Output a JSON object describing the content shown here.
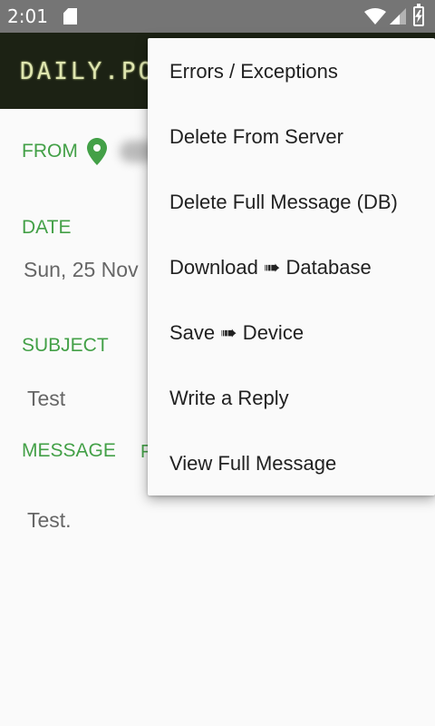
{
  "status_bar": {
    "time": "2:01",
    "icons": [
      "sd-card-icon",
      "wifi-icon",
      "signal-icon",
      "battery-charging-icon"
    ]
  },
  "app_bar": {
    "title": "DAILY.PO"
  },
  "email": {
    "from_label": "FROM",
    "date_label": "DATE",
    "date_value": "Sun, 25 Nov",
    "subject_label": "SUBJECT",
    "subject_value": "Test",
    "message_label": "MESSAGE",
    "message_extra": "F",
    "message_value": "Test."
  },
  "menu": {
    "items": [
      {
        "label": "Errors / Exceptions"
      },
      {
        "label": "Delete From Server"
      },
      {
        "label": "Delete Full Message (DB)"
      },
      {
        "label": "Download ➠ Database"
      },
      {
        "label": "Save ➠ Device"
      },
      {
        "label": "Write a Reply"
      },
      {
        "label": "View Full Message"
      }
    ]
  },
  "colors": {
    "accent": "#43a047",
    "status_bar": "#757575",
    "app_bar": "#1c2214"
  }
}
